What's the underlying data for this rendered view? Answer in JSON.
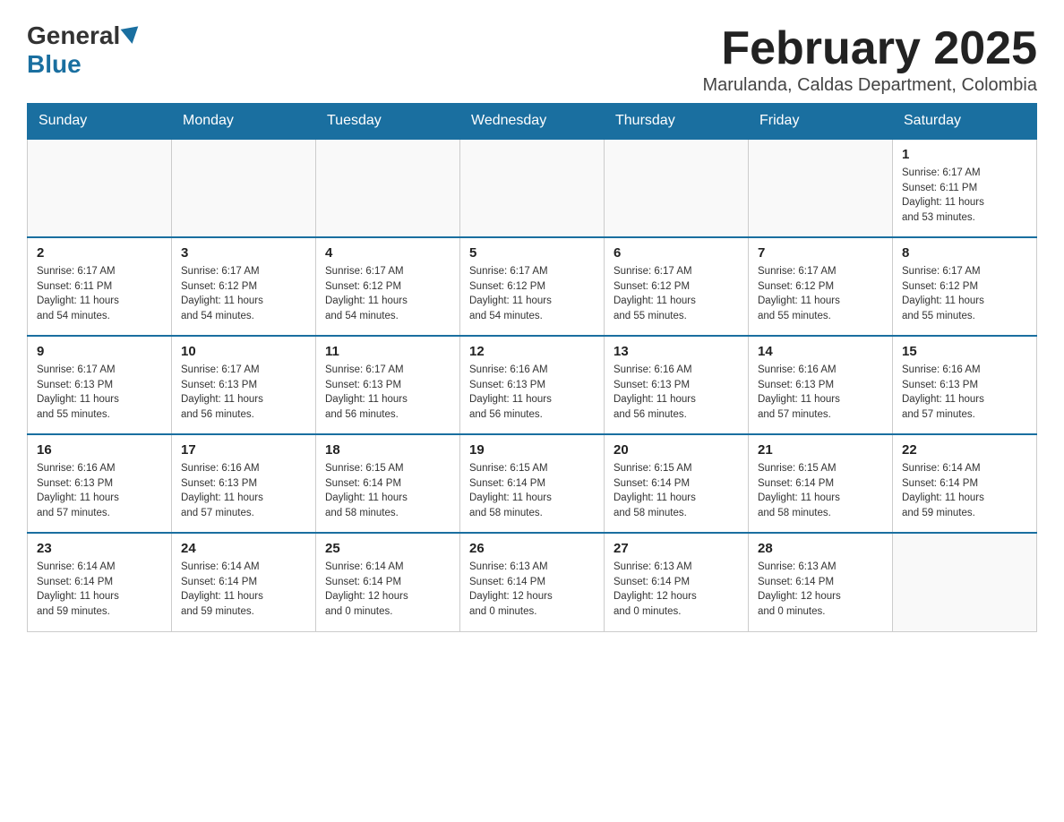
{
  "logo": {
    "general": "General",
    "blue": "Blue"
  },
  "title": "February 2025",
  "subtitle": "Marulanda, Caldas Department, Colombia",
  "days_header": [
    "Sunday",
    "Monday",
    "Tuesday",
    "Wednesday",
    "Thursday",
    "Friday",
    "Saturday"
  ],
  "weeks": [
    [
      {
        "day": "",
        "info": ""
      },
      {
        "day": "",
        "info": ""
      },
      {
        "day": "",
        "info": ""
      },
      {
        "day": "",
        "info": ""
      },
      {
        "day": "",
        "info": ""
      },
      {
        "day": "",
        "info": ""
      },
      {
        "day": "1",
        "info": "Sunrise: 6:17 AM\nSunset: 6:11 PM\nDaylight: 11 hours\nand 53 minutes."
      }
    ],
    [
      {
        "day": "2",
        "info": "Sunrise: 6:17 AM\nSunset: 6:11 PM\nDaylight: 11 hours\nand 54 minutes."
      },
      {
        "day": "3",
        "info": "Sunrise: 6:17 AM\nSunset: 6:12 PM\nDaylight: 11 hours\nand 54 minutes."
      },
      {
        "day": "4",
        "info": "Sunrise: 6:17 AM\nSunset: 6:12 PM\nDaylight: 11 hours\nand 54 minutes."
      },
      {
        "day": "5",
        "info": "Sunrise: 6:17 AM\nSunset: 6:12 PM\nDaylight: 11 hours\nand 54 minutes."
      },
      {
        "day": "6",
        "info": "Sunrise: 6:17 AM\nSunset: 6:12 PM\nDaylight: 11 hours\nand 55 minutes."
      },
      {
        "day": "7",
        "info": "Sunrise: 6:17 AM\nSunset: 6:12 PM\nDaylight: 11 hours\nand 55 minutes."
      },
      {
        "day": "8",
        "info": "Sunrise: 6:17 AM\nSunset: 6:12 PM\nDaylight: 11 hours\nand 55 minutes."
      }
    ],
    [
      {
        "day": "9",
        "info": "Sunrise: 6:17 AM\nSunset: 6:13 PM\nDaylight: 11 hours\nand 55 minutes."
      },
      {
        "day": "10",
        "info": "Sunrise: 6:17 AM\nSunset: 6:13 PM\nDaylight: 11 hours\nand 56 minutes."
      },
      {
        "day": "11",
        "info": "Sunrise: 6:17 AM\nSunset: 6:13 PM\nDaylight: 11 hours\nand 56 minutes."
      },
      {
        "day": "12",
        "info": "Sunrise: 6:16 AM\nSunset: 6:13 PM\nDaylight: 11 hours\nand 56 minutes."
      },
      {
        "day": "13",
        "info": "Sunrise: 6:16 AM\nSunset: 6:13 PM\nDaylight: 11 hours\nand 56 minutes."
      },
      {
        "day": "14",
        "info": "Sunrise: 6:16 AM\nSunset: 6:13 PM\nDaylight: 11 hours\nand 57 minutes."
      },
      {
        "day": "15",
        "info": "Sunrise: 6:16 AM\nSunset: 6:13 PM\nDaylight: 11 hours\nand 57 minutes."
      }
    ],
    [
      {
        "day": "16",
        "info": "Sunrise: 6:16 AM\nSunset: 6:13 PM\nDaylight: 11 hours\nand 57 minutes."
      },
      {
        "day": "17",
        "info": "Sunrise: 6:16 AM\nSunset: 6:13 PM\nDaylight: 11 hours\nand 57 minutes."
      },
      {
        "day": "18",
        "info": "Sunrise: 6:15 AM\nSunset: 6:14 PM\nDaylight: 11 hours\nand 58 minutes."
      },
      {
        "day": "19",
        "info": "Sunrise: 6:15 AM\nSunset: 6:14 PM\nDaylight: 11 hours\nand 58 minutes."
      },
      {
        "day": "20",
        "info": "Sunrise: 6:15 AM\nSunset: 6:14 PM\nDaylight: 11 hours\nand 58 minutes."
      },
      {
        "day": "21",
        "info": "Sunrise: 6:15 AM\nSunset: 6:14 PM\nDaylight: 11 hours\nand 58 minutes."
      },
      {
        "day": "22",
        "info": "Sunrise: 6:14 AM\nSunset: 6:14 PM\nDaylight: 11 hours\nand 59 minutes."
      }
    ],
    [
      {
        "day": "23",
        "info": "Sunrise: 6:14 AM\nSunset: 6:14 PM\nDaylight: 11 hours\nand 59 minutes."
      },
      {
        "day": "24",
        "info": "Sunrise: 6:14 AM\nSunset: 6:14 PM\nDaylight: 11 hours\nand 59 minutes."
      },
      {
        "day": "25",
        "info": "Sunrise: 6:14 AM\nSunset: 6:14 PM\nDaylight: 12 hours\nand 0 minutes."
      },
      {
        "day": "26",
        "info": "Sunrise: 6:13 AM\nSunset: 6:14 PM\nDaylight: 12 hours\nand 0 minutes."
      },
      {
        "day": "27",
        "info": "Sunrise: 6:13 AM\nSunset: 6:14 PM\nDaylight: 12 hours\nand 0 minutes."
      },
      {
        "day": "28",
        "info": "Sunrise: 6:13 AM\nSunset: 6:14 PM\nDaylight: 12 hours\nand 0 minutes."
      },
      {
        "day": "",
        "info": ""
      }
    ]
  ]
}
